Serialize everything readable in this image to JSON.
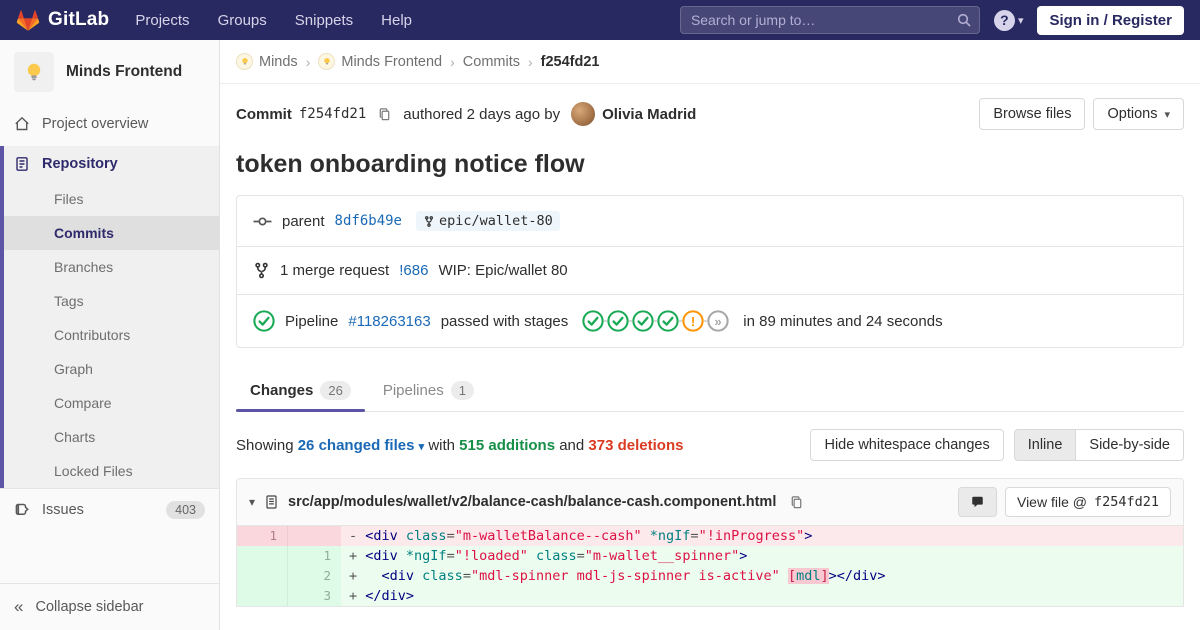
{
  "colors": {
    "navbar-bg": "#292961",
    "accent": "#5c55a5",
    "link": "#1b69b6",
    "green": "#1aaa55",
    "orange": "#fc9403",
    "green-text": "#168f48",
    "red-text": "#db3b21"
  },
  "navbar": {
    "logo_text": "GitLab",
    "menu": [
      "Projects",
      "Groups",
      "Snippets",
      "Help"
    ],
    "search_placeholder": "Search or jump to…",
    "help_icon": "?",
    "sign_in_label": "Sign in / Register"
  },
  "sidebar": {
    "project_name": "Minds Frontend",
    "overview_label": "Project overview",
    "repository_label": "Repository",
    "repo_items": [
      "Files",
      "Commits",
      "Branches",
      "Tags",
      "Contributors",
      "Graph",
      "Compare",
      "Charts",
      "Locked Files"
    ],
    "active_repo_item": "Commits",
    "issues_label": "Issues",
    "issues_count": "403",
    "collapse_icon": "«",
    "collapse_label": "Collapse sidebar"
  },
  "breadcrumb": {
    "separator": "›",
    "items": [
      {
        "label": "Minds",
        "avatar": true
      },
      {
        "label": "Minds Frontend",
        "avatar": true
      },
      {
        "label": "Commits",
        "avatar": false
      }
    ],
    "current": "f254fd21"
  },
  "commit": {
    "label": "Commit",
    "sha": "f254fd21",
    "authored_text": "authored 2 days ago by",
    "author": "Olivia Madrid",
    "browse_files_label": "Browse files",
    "options_label": "Options",
    "options_caret": "▾",
    "title": "token onboarding notice flow",
    "parent_label": "parent",
    "parent_sha": "8df6b49e",
    "branch": "epic/wallet-80",
    "mr_text": "1 merge request",
    "mr_ref": "!686",
    "mr_title": "WIP: Epic/wallet 80",
    "pipeline_label": "Pipeline",
    "pipeline_id": "#118263163",
    "pipeline_status_text": "passed with stages",
    "pipeline_stages": [
      "success",
      "success",
      "success",
      "success",
      "warning",
      "skipped"
    ],
    "skipped_glyph": "»",
    "warning_glyph": "!",
    "pipeline_duration": "in 89 minutes and 24 seconds"
  },
  "tabs": [
    {
      "label": "Changes",
      "count": "26",
      "active": true
    },
    {
      "label": "Pipelines",
      "count": "1",
      "active": false
    }
  ],
  "changes_summary": {
    "showing": "Showing",
    "files": "26 changed files",
    "files_caret": "▾",
    "with_word": "with",
    "additions": "515 additions",
    "and_word": "and",
    "deletions": "373 deletions",
    "hide_whitespace_label": "Hide whitespace changes",
    "inline_label": "Inline",
    "side_by_side_label": "Side-by-side"
  },
  "diff": {
    "collapse_caret": "▾",
    "file_path": "src/app/modules/wallet/v2/balance-cash/balance-cash.component.html",
    "view_file_label": "View file @",
    "view_file_sha": "f254fd21",
    "lines": [
      {
        "old": "1",
        "new": "",
        "type": "removed",
        "segments": [
          [
            "- ",
            "pl"
          ],
          [
            "<div",
            "nt"
          ],
          [
            " ",
            "pl"
          ],
          [
            "class",
            "na"
          ],
          [
            "=",
            "pl"
          ],
          [
            "\"m-walletBalance--cash\"",
            "s"
          ],
          [
            " ",
            "pl"
          ],
          [
            "*ngIf",
            "na"
          ],
          [
            "=",
            "pl"
          ],
          [
            "\"!inProgress\"",
            "s"
          ],
          [
            ">",
            "nt"
          ]
        ]
      },
      {
        "old": "",
        "new": "1",
        "type": "added",
        "segments": [
          [
            "+ ",
            "pl"
          ],
          [
            "<div",
            "nt"
          ],
          [
            " ",
            "pl"
          ],
          [
            "*ngIf",
            "na"
          ],
          [
            "=",
            "pl"
          ],
          [
            "\"!loaded\"",
            "s"
          ],
          [
            " ",
            "pl"
          ],
          [
            "class",
            "na"
          ],
          [
            "=",
            "pl"
          ],
          [
            "\"m-wallet__spinner\"",
            "s"
          ],
          [
            ">",
            "nt"
          ]
        ]
      },
      {
        "old": "",
        "new": "2",
        "type": "added",
        "segments": [
          [
            "+   ",
            "pl"
          ],
          [
            "<div",
            "nt"
          ],
          [
            " ",
            "pl"
          ],
          [
            "class",
            "na"
          ],
          [
            "=",
            "pl"
          ],
          [
            "\"mdl-spinner mdl-js-spinner is-active\"",
            "s"
          ],
          [
            " ",
            "pl"
          ],
          [
            "[",
            "err"
          ],
          [
            "mdl",
            "errna"
          ],
          [
            "]",
            "err"
          ],
          [
            ">",
            "nt"
          ],
          [
            "</div>",
            "nt"
          ]
        ]
      },
      {
        "old": "",
        "new": "3",
        "type": "added",
        "segments": [
          [
            "+ ",
            "pl"
          ],
          [
            "</div>",
            "nt"
          ]
        ]
      }
    ]
  }
}
